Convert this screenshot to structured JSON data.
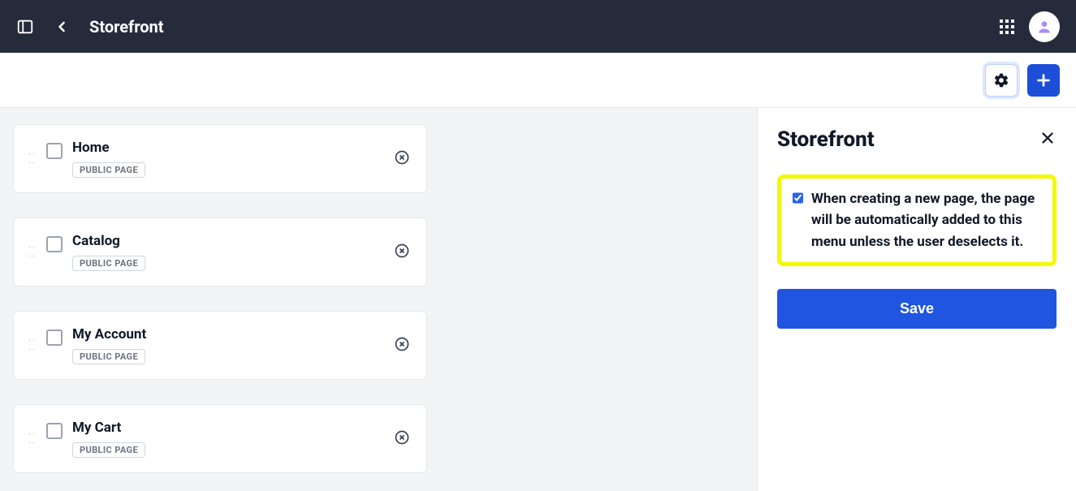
{
  "header": {
    "title": "Storefront"
  },
  "pages": [
    {
      "name": "Home",
      "badge": "PUBLIC PAGE"
    },
    {
      "name": "Catalog",
      "badge": "PUBLIC PAGE"
    },
    {
      "name": "My Account",
      "badge": "PUBLIC PAGE"
    },
    {
      "name": "My Cart",
      "badge": "PUBLIC PAGE"
    }
  ],
  "sidepanel": {
    "title": "Storefront",
    "auto_add_checked": true,
    "auto_add_label": "When creating a new page, the page will be automatically added to this menu unless the user deselects it.",
    "save_label": "Save"
  }
}
